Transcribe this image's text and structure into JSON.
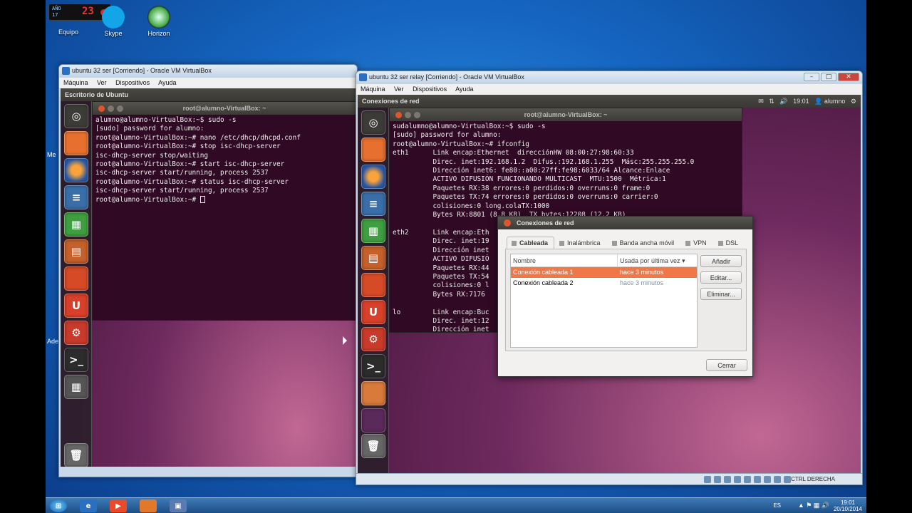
{
  "desktop": {
    "icons": [
      "Equipo",
      "Skype",
      "Horizon"
    ],
    "clock_widget": {
      "big": "23",
      "small_top": "AÑO",
      "small_bottom": "17"
    },
    "edge_labels": [
      "Me",
      "Ade"
    ]
  },
  "vm_left": {
    "title": "ubuntu 32 ser [Corriendo] - Oracle VM VirtualBox",
    "menu": [
      "Máquina",
      "Ver",
      "Dispositivos",
      "Ayuda"
    ],
    "guest_title": "Escritorio de Ubuntu",
    "terminal_title": "root@alumno-VirtualBox: ~",
    "terminal_lines": [
      "alumno@alumno-VirtualBox:~$ sudo -s",
      "[sudo] password for alumno:",
      "root@alumno-VirtualBox:~# nano /etc/dhcp/dhcpd.conf",
      "root@alumno-VirtualBox:~# stop isc-dhcp-server",
      "isc-dhcp-server stop/waiting",
      "root@alumno-VirtualBox:~# start isc-dhcp-server",
      "isc-dhcp-server start/running, process 2537",
      "root@alumno-VirtualBox:~# status isc-dhcp-server",
      "isc-dhcp-server start/running, process 2537",
      "root@alumno-VirtualBox:~# "
    ]
  },
  "vm_right": {
    "title": "ubuntu 32 ser relay [Corriendo] - Oracle VM VirtualBox",
    "menu": [
      "Máquina",
      "Ver",
      "Dispositivos",
      "Ayuda"
    ],
    "guest_title": "Conexiones de red",
    "panel_time": "19:01",
    "panel_user": "alumno",
    "terminal_title": "root@alumno-VirtualBox: ~",
    "terminal_lines": [
      "sudalumno@alumno-VirtualBox:~$ sudo -s",
      "[sudo] password for alumno:",
      "root@alumno-VirtualBox:~# ifconfig",
      "eth1      Link encap:Ethernet  direcciónHW 08:00:27:98:60:33",
      "          Direc. inet:192.168.1.2  Difus.:192.168.1.255  Másc:255.255.255.0",
      "          Dirección inet6: fe80::a00:27ff:fe98:6033/64 Alcance:Enlace",
      "          ACTIVO DIFUSIÓN FUNCIONANDO MULTICAST  MTU:1500  Métrica:1",
      "          Paquetes RX:38 errores:0 perdidos:0 overruns:0 frame:0",
      "          Paquetes TX:74 errores:0 perdidos:0 overruns:0 carrier:0",
      "          colisiones:0 long.colaTX:1000",
      "          Bytes RX:8801 (8.8 KB)  TX bytes:12208 (12.2 KB)",
      "",
      "eth2      Link encap:Eth",
      "          Direc. inet:19",
      "          Dirección inet",
      "          ACTIVO DIFUSIÓ",
      "          Paquetes RX:44",
      "          Paquetes TX:54",
      "          colisiones:0 l",
      "          Bytes RX:7176",
      "",
      "lo        Link encap:Buc",
      "          Direc. inet:12",
      "          Dirección inet"
    ],
    "host_key": "CTRL DERECHA"
  },
  "dialog": {
    "title": "Conexiones de red",
    "tabs": [
      "Cableada",
      "Inalámbrica",
      "Banda ancha móvil",
      "VPN",
      "DSL"
    ],
    "columns": [
      "Nombre",
      "Usada por última vez ▾"
    ],
    "rows": [
      {
        "name": "Conexión cableada 1",
        "last": "hace 3 minutos"
      },
      {
        "name": "Conexión cableada 2",
        "last": "hace 3 minutos"
      }
    ],
    "buttons": {
      "add": "Añadir",
      "edit": "Editar...",
      "delete": "Eliminar...",
      "close": "Cerrar"
    }
  },
  "taskbar": {
    "lang": "ES",
    "time": "19:01",
    "date": "20/10/2014"
  },
  "colors": {
    "accent": "#f07746",
    "terminal_bg": "#300a24"
  }
}
